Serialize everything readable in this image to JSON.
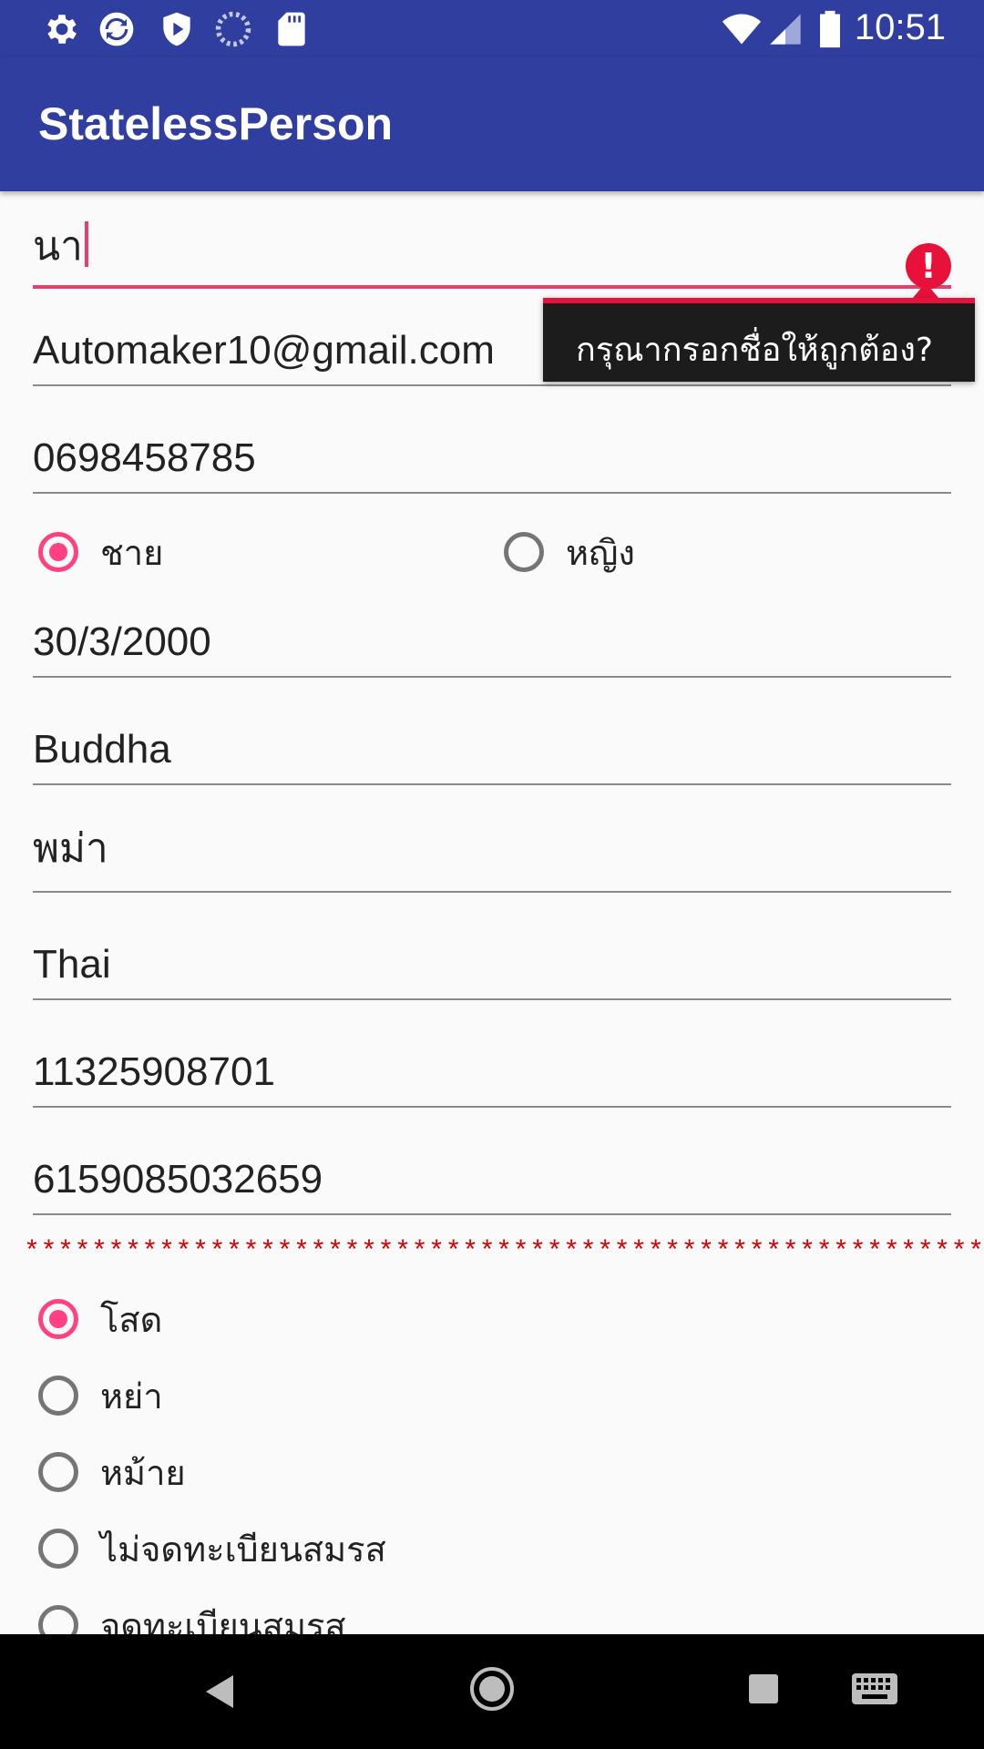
{
  "status_bar": {
    "time": "10:51",
    "left_icons": [
      "settings-icon",
      "sync-icon",
      "shield-play-icon",
      "loading-icon",
      "sd-card-icon"
    ],
    "right_icons": [
      "wifi-icon",
      "signal-icon",
      "battery-icon"
    ]
  },
  "app_bar": {
    "title": "StatelessPerson"
  },
  "form": {
    "name": {
      "value": "นา",
      "error": "กรุณากรอกชื่อให้ถูกต้อง?"
    },
    "email": {
      "value": "Automaker10@gmail.com"
    },
    "phone": {
      "value": "0698458785"
    },
    "gender": {
      "options": [
        "ชาย",
        "หญิง"
      ],
      "selected": "ชาย"
    },
    "birthdate": {
      "value": "30/3/2000"
    },
    "religion": {
      "value": "Buddha"
    },
    "origin": {
      "value": "พม่า"
    },
    "nationality": {
      "value": "Thai"
    },
    "id_number_1": {
      "value": "11325908701"
    },
    "id_number_2": {
      "value": "6159085032659"
    },
    "separator": "*************************************************************",
    "marital_status": {
      "options": [
        "โสด",
        "หย่า",
        "หม้าย",
        "ไม่จดทะเบียนสมรส",
        "จดทะเบียนสมรส"
      ],
      "selected": "โสด"
    }
  },
  "colors": {
    "primary": "#303f9f",
    "accent": "#ff4081",
    "error": "#e8113a"
  },
  "nav_bar": {
    "buttons": [
      "back-icon",
      "home-icon",
      "recents-icon",
      "keyboard-icon"
    ]
  }
}
